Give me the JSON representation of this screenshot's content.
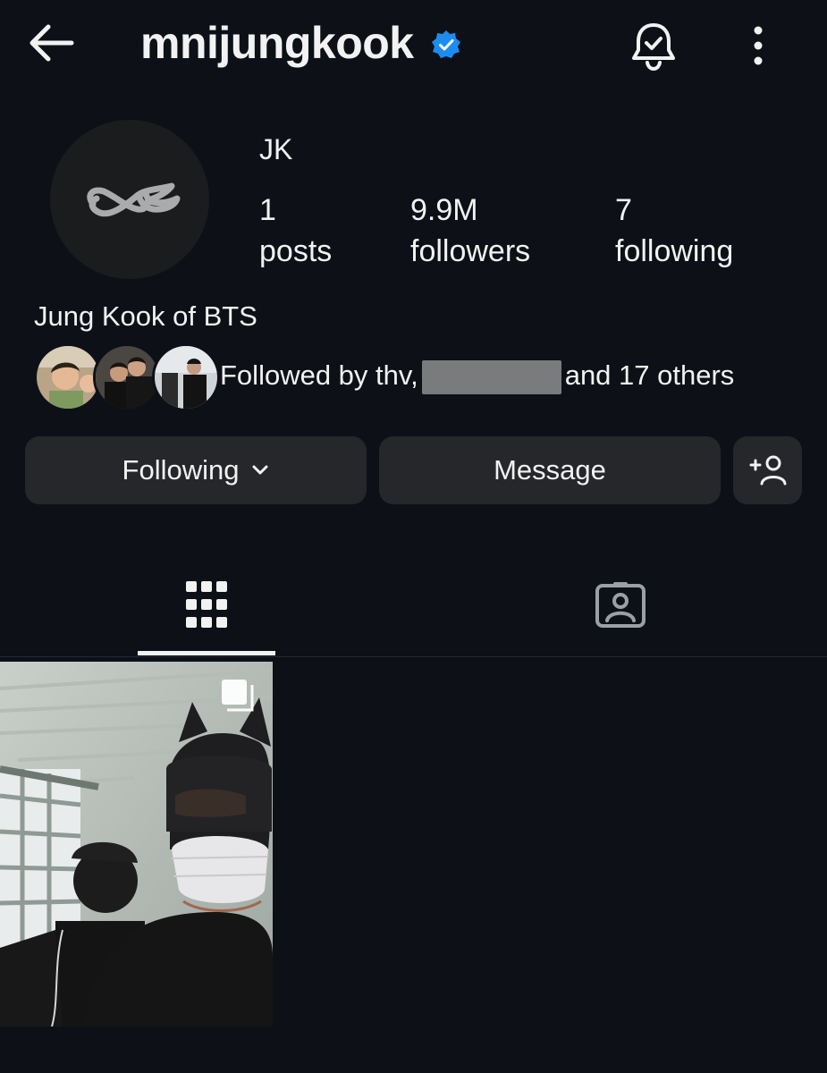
{
  "header": {
    "username": "mnijungkook",
    "icons": {
      "back": "back-arrow-icon",
      "verified": "verified-badge-icon",
      "notifications": "bell-icon",
      "more": "more-vertical-icon"
    }
  },
  "profile": {
    "display_name": "JK",
    "bio": "Jung Kook of BTS",
    "stats": [
      {
        "value": "1",
        "label": "posts"
      },
      {
        "value": "9.9M",
        "label": "followers"
      },
      {
        "value": "7",
        "label": "following"
      }
    ],
    "followed_by_prefix": "Followed by thv,",
    "followed_by_suffix": "and 17 others"
  },
  "actions": {
    "following_label": "Following",
    "message_label": "Message",
    "add_user_icon": "add-user-icon"
  },
  "tabs": [
    {
      "name": "posts-grid",
      "icon": "grid-icon",
      "active": true
    },
    {
      "name": "tagged",
      "icon": "tagged-person-icon",
      "active": false
    }
  ],
  "colors": {
    "background": "#0d1117",
    "button": "#25272b",
    "verified": "#1d8cf0",
    "text": "#f2f2f2"
  }
}
